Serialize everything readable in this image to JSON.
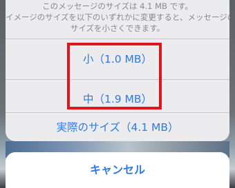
{
  "sheet": {
    "message_line1": "このメッセージのサイズは 4.1 MB です。",
    "message_line2": "イメージのサイズを以下のいずれかに変更すると、メッセージの",
    "message_line3": "サイズを小さくできます。",
    "options": [
      {
        "label": "小（1.0 MB）"
      },
      {
        "label": "中（1.9 MB）"
      },
      {
        "label": "実際のサイズ（4.1 MB）"
      }
    ]
  },
  "cancel_label": "キャンセル",
  "colors": {
    "accent": "#2f7ae5",
    "highlight": "#e0161f",
    "sheet_bg": "#ececee",
    "message_text": "#8a8a8e"
  }
}
